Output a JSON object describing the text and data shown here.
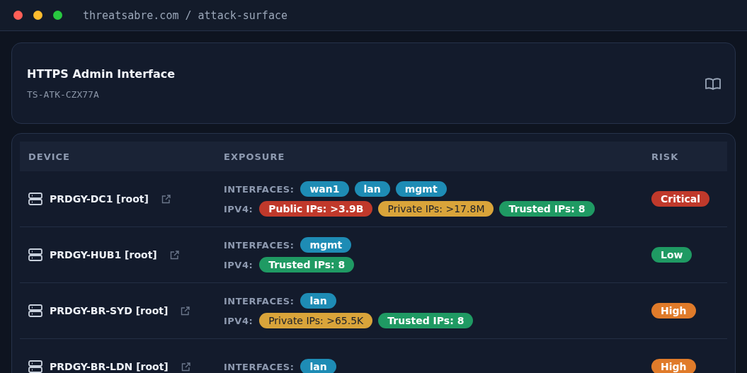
{
  "window": {
    "title": "threatsabre.com / attack-surface"
  },
  "header": {
    "title": "HTTPS Admin Interface",
    "code": "TS-ATK-CZX77A"
  },
  "table": {
    "columns": [
      "DEVICE",
      "EXPOSURE",
      "RISK"
    ],
    "rows": [
      {
        "device": "PRDGY-DC1 [root]",
        "interfaces_label": "INTERFACES:",
        "interfaces": [
          "wan1",
          "lan",
          "mgmt"
        ],
        "ipv4_label": "IPV4:",
        "ipv4": [
          {
            "kind": "public",
            "text": "Public IPs: >3.9B"
          },
          {
            "kind": "private",
            "text": "Private IPs: >17.8M"
          },
          {
            "kind": "trusted",
            "text": "Trusted IPs: 8"
          }
        ],
        "risk": {
          "kind": "critical",
          "text": "Critical"
        }
      },
      {
        "device": "PRDGY-HUB1 [root]",
        "interfaces_label": "INTERFACES:",
        "interfaces": [
          "mgmt"
        ],
        "ipv4_label": "IPV4:",
        "ipv4": [
          {
            "kind": "trusted",
            "text": "Trusted IPs: 8"
          }
        ],
        "risk": {
          "kind": "low",
          "text": "Low"
        }
      },
      {
        "device": "PRDGY-BR-SYD [root]",
        "interfaces_label": "INTERFACES:",
        "interfaces": [
          "lan"
        ],
        "ipv4_label": "IPV4:",
        "ipv4": [
          {
            "kind": "private",
            "text": "Private IPs: >65.5K"
          },
          {
            "kind": "trusted",
            "text": "Trusted IPs: 8"
          }
        ],
        "risk": {
          "kind": "high",
          "text": "High"
        }
      },
      {
        "device": "PRDGY-BR-LDN [root]",
        "interfaces_label": "INTERFACES:",
        "interfaces": [
          "lan"
        ],
        "ipv4": [],
        "risk": {
          "kind": "high",
          "text": "High"
        }
      }
    ]
  }
}
